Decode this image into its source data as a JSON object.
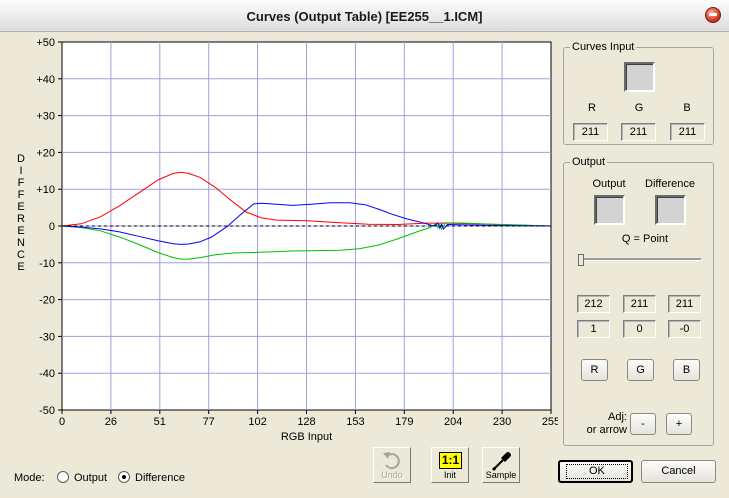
{
  "window": {
    "title": "Curves (Output Table) [EE255__1.ICM]"
  },
  "graph": {
    "ylabel": "DIFFERENCE",
    "xlabel": "RGB Input",
    "y_ticks": [
      "+50",
      "+40",
      "+30",
      "+20",
      "+10",
      "0",
      "-10",
      "-20",
      "-30",
      "-40",
      "-50"
    ],
    "x_ticks": [
      "0",
      "26",
      "51",
      "77",
      "102",
      "128",
      "153",
      "179",
      "204",
      "230",
      "255"
    ]
  },
  "chart_data": {
    "type": "line",
    "xlabel": "RGB Input",
    "ylabel": "DIFFERENCE",
    "xlim": [
      0,
      255
    ],
    "ylim": [
      -50,
      50
    ],
    "grid": true,
    "series": [
      {
        "color": "#ff0000",
        "points": [
          [
            0,
            0
          ],
          [
            10,
            0.6
          ],
          [
            20,
            2.5
          ],
          [
            30,
            5.5
          ],
          [
            40,
            9
          ],
          [
            50,
            12.5
          ],
          [
            58,
            14.3
          ],
          [
            62,
            14.6
          ],
          [
            66,
            14.3
          ],
          [
            72,
            13.2
          ],
          [
            80,
            10.5
          ],
          [
            88,
            7
          ],
          [
            96,
            3.8
          ],
          [
            104,
            2.2
          ],
          [
            112,
            1.6
          ],
          [
            128,
            1.4
          ],
          [
            145,
            0.9
          ],
          [
            160,
            0.5
          ],
          [
            175,
            0.4
          ],
          [
            190,
            0.8
          ],
          [
            200,
            0.8
          ],
          [
            215,
            0.6
          ],
          [
            240,
            0.2
          ],
          [
            255,
            0
          ]
        ]
      },
      {
        "color": "#00c000",
        "points": [
          [
            0,
            0
          ],
          [
            10,
            -0.4
          ],
          [
            20,
            -1.3
          ],
          [
            30,
            -3
          ],
          [
            40,
            -5
          ],
          [
            50,
            -7.2
          ],
          [
            58,
            -8.6
          ],
          [
            62,
            -9
          ],
          [
            66,
            -9
          ],
          [
            72,
            -8.6
          ],
          [
            80,
            -7.8
          ],
          [
            90,
            -7.3
          ],
          [
            100,
            -7.2
          ],
          [
            110,
            -7
          ],
          [
            120,
            -6.8
          ],
          [
            130,
            -6.7
          ],
          [
            145,
            -6.6
          ],
          [
            155,
            -6.2
          ],
          [
            165,
            -5.2
          ],
          [
            175,
            -3.5
          ],
          [
            185,
            -1.6
          ],
          [
            192,
            -0.4
          ],
          [
            195,
            0.6
          ],
          [
            196,
            -0.4
          ],
          [
            197,
            0.4
          ],
          [
            198,
            -0.9
          ],
          [
            200,
            0.9
          ],
          [
            210,
            0.8
          ],
          [
            225,
            0.5
          ],
          [
            255,
            0
          ]
        ]
      },
      {
        "color": "#0000ff",
        "points": [
          [
            0,
            0
          ],
          [
            10,
            -0.3
          ],
          [
            20,
            -0.8
          ],
          [
            30,
            -1.6
          ],
          [
            40,
            -2.8
          ],
          [
            50,
            -4
          ],
          [
            58,
            -4.8
          ],
          [
            62,
            -5
          ],
          [
            66,
            -4.9
          ],
          [
            72,
            -4.3
          ],
          [
            78,
            -3
          ],
          [
            86,
            -0.2
          ],
          [
            94,
            3.5
          ],
          [
            100,
            6
          ],
          [
            104,
            6.2
          ],
          [
            112,
            5.9
          ],
          [
            120,
            5.6
          ],
          [
            130,
            5.9
          ],
          [
            140,
            6.3
          ],
          [
            150,
            6.3
          ],
          [
            158,
            5.8
          ],
          [
            165,
            4.6
          ],
          [
            172,
            3.2
          ],
          [
            180,
            1.9
          ],
          [
            188,
            0.9
          ],
          [
            194,
            0
          ],
          [
            196,
            0.8
          ],
          [
            197,
            -0.6
          ],
          [
            198,
            0.5
          ],
          [
            199,
            -0.8
          ],
          [
            201,
            0.4
          ],
          [
            210,
            0.3
          ],
          [
            230,
            0.1
          ],
          [
            255,
            0
          ]
        ]
      },
      {
        "color": "#000000",
        "dashed": true,
        "points": [
          [
            0,
            0
          ],
          [
            255,
            0
          ]
        ]
      }
    ]
  },
  "curves_input": {
    "title": "Curves Input",
    "labels": [
      "R",
      "G",
      "B"
    ],
    "values": [
      "211",
      "211",
      "211"
    ],
    "swatch_color": "#d3d3d3"
  },
  "output": {
    "title": "Output",
    "output_label": "Output",
    "difference_label": "Difference",
    "output_swatch_color": "#d4d3d3",
    "difference_swatch_color": "#d3d3d3",
    "q_label": "Q =  Point",
    "slider_value": 0,
    "row1": [
      "212",
      "211",
      "211"
    ],
    "row2": [
      "1",
      "0",
      "-0"
    ],
    "channel_buttons": [
      "R",
      "G",
      "B"
    ],
    "adj_label_1": "Adj:",
    "adj_label_2": "or arrow",
    "minus_label": "-",
    "plus_label": "+"
  },
  "toolbar": {
    "undo_label": "Undo",
    "init_label": "Init",
    "init_badge": "1:1",
    "sample_label": "Sample"
  },
  "mode": {
    "label": "Mode:",
    "options": [
      "Output",
      "Difference"
    ],
    "selected": "Difference"
  },
  "buttons": {
    "ok": "OK",
    "cancel": "Cancel"
  }
}
